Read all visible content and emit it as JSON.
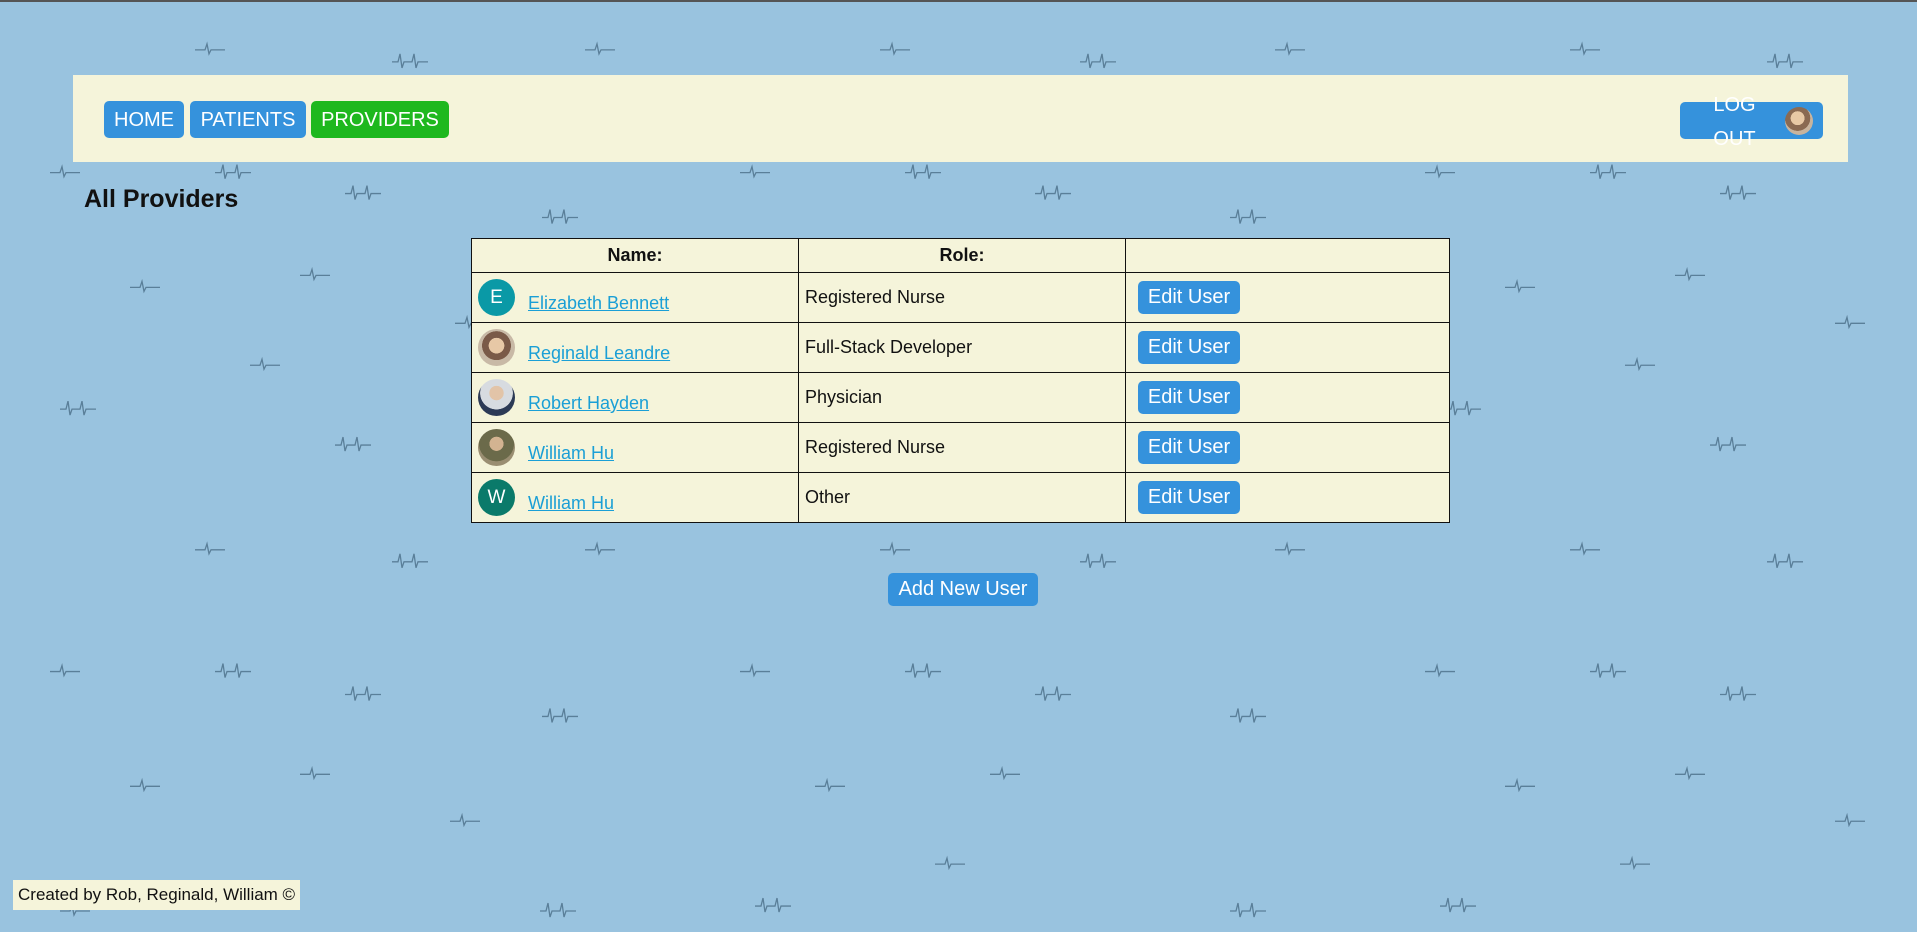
{
  "nav": {
    "home_label": "HOME",
    "patients_label": "PATIENTS",
    "providers_label": "PROVIDERS",
    "logout_label": "LOG OUT"
  },
  "page": {
    "title": "All Providers"
  },
  "table": {
    "headers": [
      "Name:",
      "Role:",
      ""
    ],
    "rows": [
      {
        "avatar_letter": "E",
        "name": "Elizabeth Bennett",
        "role": "Registered Nurse",
        "action": "Edit User"
      },
      {
        "avatar_letter": "",
        "name": "Reginald Leandre",
        "role": "Full-Stack Developer",
        "action": "Edit User"
      },
      {
        "avatar_letter": "",
        "name": "Robert Hayden",
        "role": "Physician",
        "action": "Edit User"
      },
      {
        "avatar_letter": "",
        "name": "William Hu",
        "role": "Registered Nurse",
        "action": "Edit User"
      },
      {
        "avatar_letter": "W",
        "name": "William Hu",
        "role": "Other",
        "action": "Edit User"
      }
    ]
  },
  "actions": {
    "add_user_label": "Add New User"
  },
  "footer": {
    "text": "Created by Rob, Reginald, William ©"
  },
  "colors": {
    "background": "#99c3df",
    "panel": "#f5f4da",
    "primary_button": "#3592dc",
    "active_nav": "#1eb81e",
    "link": "#1a9fd6"
  }
}
